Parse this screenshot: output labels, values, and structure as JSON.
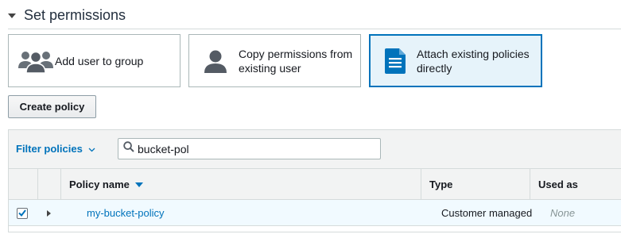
{
  "section": {
    "title": "Set permissions"
  },
  "options": [
    {
      "label": "Add user to group",
      "icon": "group-icon"
    },
    {
      "label_line1": "Copy permissions from",
      "label_line2": "existing user",
      "icon": "user-icon"
    },
    {
      "label_line1": "Attach existing policies",
      "label_line2": "directly",
      "icon": "document-icon"
    }
  ],
  "actions": {
    "create_policy": "Create policy"
  },
  "filter": {
    "dropdown_label": "Filter policies",
    "search_value": "bucket-pol"
  },
  "table": {
    "columns": [
      "Policy name",
      "Type",
      "Used as"
    ],
    "rows": [
      {
        "checked": true,
        "name": "my-bucket-policy",
        "type": "Customer managed",
        "used_as": "None"
      }
    ]
  },
  "colors": {
    "accent": "#0073bb",
    "selected_bg": "#e6f3fa",
    "row_bg": "#f1faff",
    "header_bg": "#f2f3f3"
  }
}
